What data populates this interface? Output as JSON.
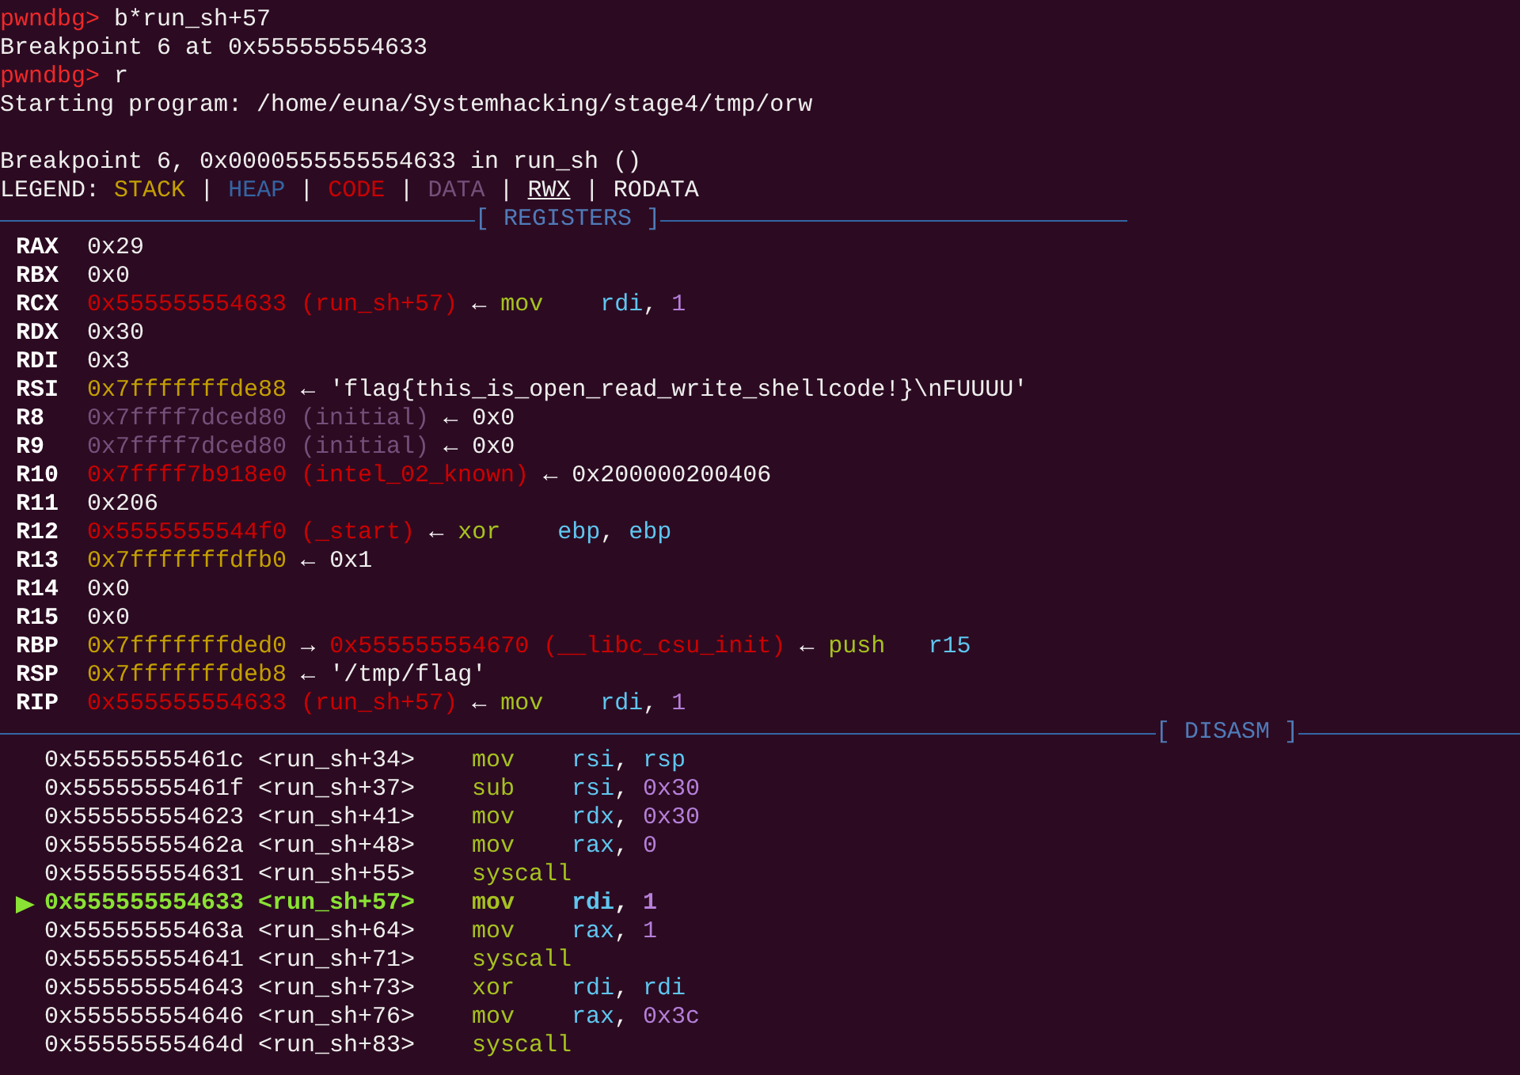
{
  "console": [
    {
      "kind": "output",
      "segments": [
        {
          "text": "pwndbg>",
          "kind": "prompt"
        },
        {
          "text": "b*run_sh+57",
          "kind": "plain"
        }
      ]
    },
    {
      "kind": "output",
      "segments": [
        {
          "text": "Breakpoint 6 at 0x555555554633",
          "kind": "plain"
        }
      ]
    },
    {
      "kind": "output",
      "segments": [
        {
          "text": "pwndbg>",
          "kind": "prompt"
        },
        {
          "text": "r",
          "kind": "plain"
        }
      ]
    },
    {
      "kind": "output",
      "segments": [
        {
          "text": "Starting program: /home/euna/Systemhacking/stage4/tmp/orw",
          "kind": "plain"
        }
      ]
    },
    {
      "kind": "blank"
    },
    {
      "kind": "output",
      "segments": [
        {
          "text": "Breakpoint 6, 0x0000555555554633 in run_sh ()",
          "kind": "plain"
        }
      ]
    },
    {
      "kind": "output",
      "segments": [
        {
          "text": "LEGEND:",
          "kind": "plain"
        },
        {
          "text": "STACK",
          "kind": "stack"
        },
        {
          "text": "|",
          "kind": "plain"
        },
        {
          "text": "HEAP",
          "kind": "heap"
        },
        {
          "text": "|",
          "kind": "plain"
        },
        {
          "text": "CODE",
          "kind": "code"
        },
        {
          "text": "|",
          "kind": "plain"
        },
        {
          "text": "DATA",
          "kind": "data"
        },
        {
          "text": "|",
          "kind": "plain"
        },
        {
          "text": "RWX",
          "kind": "rwx"
        },
        {
          "text": "|",
          "kind": "plain"
        },
        {
          "text": "RODATA",
          "kind": "plain"
        }
      ]
    }
  ],
  "registers_header": "[ REGISTERS ]",
  "registers": [
    {
      "name": "RAX",
      "segments": [
        {
          "text": "0x29",
          "kind": "plain"
        }
      ]
    },
    {
      "name": "RBX",
      "segments": [
        {
          "text": "0x0",
          "kind": "plain"
        }
      ]
    },
    {
      "name": "RCX",
      "segments": [
        {
          "text": "0x555555554633 (run_sh+57)",
          "kind": "code"
        },
        {
          "text": "←",
          "kind": "arrow"
        },
        {
          "text": "mov",
          "kind": "op"
        },
        {
          "text": "rdi",
          "kind": "reg"
        },
        {
          "text": ",",
          "kind": "punct"
        },
        {
          "text": "1",
          "kind": "num"
        }
      ]
    },
    {
      "name": "RDX",
      "segments": [
        {
          "text": "0x30",
          "kind": "plain"
        }
      ]
    },
    {
      "name": "RDI",
      "segments": [
        {
          "text": "0x3",
          "kind": "plain"
        }
      ]
    },
    {
      "name": "RSI",
      "segments": [
        {
          "text": "0x7fffffffde88",
          "kind": "stack"
        },
        {
          "text": "←",
          "kind": "arrow"
        },
        {
          "text": "'flag{this_is_open_read_write_shellcode!}\\nFUUUU'",
          "kind": "plain"
        }
      ]
    },
    {
      "name": "R8",
      "segments": [
        {
          "text": "0x7ffff7dced80 (initial)",
          "kind": "data"
        },
        {
          "text": "←",
          "kind": "arrow"
        },
        {
          "text": "0x0",
          "kind": "plain"
        }
      ]
    },
    {
      "name": "R9",
      "segments": [
        {
          "text": "0x7ffff7dced80 (initial)",
          "kind": "data"
        },
        {
          "text": "←",
          "kind": "arrow"
        },
        {
          "text": "0x0",
          "kind": "plain"
        }
      ]
    },
    {
      "name": "R10",
      "segments": [
        {
          "text": "0x7ffff7b918e0 (intel_02_known)",
          "kind": "code"
        },
        {
          "text": "←",
          "kind": "arrow"
        },
        {
          "text": "0x200000200406",
          "kind": "plain"
        }
      ]
    },
    {
      "name": "R11",
      "segments": [
        {
          "text": "0x206",
          "kind": "plain"
        }
      ]
    },
    {
      "name": "R12",
      "segments": [
        {
          "text": "0x5555555544f0 (_start)",
          "kind": "code"
        },
        {
          "text": "←",
          "kind": "arrow"
        },
        {
          "text": "xor",
          "kind": "op"
        },
        {
          "text": "ebp",
          "kind": "reg"
        },
        {
          "text": ",",
          "kind": "punct"
        },
        {
          "text": "ebp",
          "kind": "reg"
        }
      ]
    },
    {
      "name": "R13",
      "segments": [
        {
          "text": "0x7fffffffdfb0",
          "kind": "stack"
        },
        {
          "text": "←",
          "kind": "arrow"
        },
        {
          "text": "0x1",
          "kind": "plain"
        }
      ]
    },
    {
      "name": "R14",
      "segments": [
        {
          "text": "0x0",
          "kind": "plain"
        }
      ]
    },
    {
      "name": "R15",
      "segments": [
        {
          "text": "0x0",
          "kind": "plain"
        }
      ]
    },
    {
      "name": "RBP",
      "segments": [
        {
          "text": "0x7fffffffded0",
          "kind": "stack"
        },
        {
          "text": "→",
          "kind": "arrow"
        },
        {
          "text": "0x555555554670 (__libc_csu_init)",
          "kind": "code"
        },
        {
          "text": "←",
          "kind": "arrow"
        },
        {
          "text": "push",
          "kind": "op"
        },
        {
          "text": "r15",
          "kind": "reg"
        }
      ]
    },
    {
      "name": "RSP",
      "segments": [
        {
          "text": "0x7fffffffdeb8",
          "kind": "stack"
        },
        {
          "text": "←",
          "kind": "arrow"
        },
        {
          "text": "'/tmp/flag'",
          "kind": "plain"
        }
      ]
    },
    {
      "name": "RIP",
      "segments": [
        {
          "text": "0x555555554633 (run_sh+57)",
          "kind": "code"
        },
        {
          "text": "←",
          "kind": "arrow"
        },
        {
          "text": "mov",
          "kind": "op"
        },
        {
          "text": "rdi",
          "kind": "reg"
        },
        {
          "text": ",",
          "kind": "punct"
        },
        {
          "text": "1",
          "kind": "num"
        }
      ]
    }
  ],
  "disasm_header": "[ DISASM ]",
  "disasm": [
    {
      "address": "0x55555555461c",
      "symbol": "<run_sh+34>",
      "mnemonic": "mov",
      "operands": [
        {
          "text": "rsi",
          "kind": "reg"
        },
        {
          "text": ",",
          "kind": "punct"
        },
        {
          "text": "rsp",
          "kind": "reg"
        }
      ],
      "selected": false
    },
    {
      "address": "0x55555555461f",
      "symbol": "<run_sh+37>",
      "mnemonic": "sub",
      "operands": [
        {
          "text": "rsi",
          "kind": "reg"
        },
        {
          "text": ",",
          "kind": "punct"
        },
        {
          "text": "0x30",
          "kind": "num"
        }
      ],
      "selected": false
    },
    {
      "address": "0x555555554623",
      "symbol": "<run_sh+41>",
      "mnemonic": "mov",
      "operands": [
        {
          "text": "rdx",
          "kind": "reg"
        },
        {
          "text": ",",
          "kind": "punct"
        },
        {
          "text": "0x30",
          "kind": "num"
        }
      ],
      "selected": false
    },
    {
      "address": "0x55555555462a",
      "symbol": "<run_sh+48>",
      "mnemonic": "mov",
      "operands": [
        {
          "text": "rax",
          "kind": "reg"
        },
        {
          "text": ",",
          "kind": "punct"
        },
        {
          "text": "0",
          "kind": "num"
        }
      ],
      "selected": false
    },
    {
      "address": "0x555555554631",
      "symbol": "<run_sh+55>",
      "mnemonic": "syscall",
      "selected": false
    },
    {
      "address": "0x555555554633",
      "symbol": "<run_sh+57>",
      "mnemonic": "mov",
      "operands": [
        {
          "text": "rdi",
          "kind": "reg"
        },
        {
          "text": ",",
          "kind": "punct"
        },
        {
          "text": "1",
          "kind": "num"
        }
      ],
      "selected": true
    },
    {
      "address": "0x55555555463a",
      "symbol": "<run_sh+64>",
      "mnemonic": "mov",
      "operands": [
        {
          "text": "rax",
          "kind": "reg"
        },
        {
          "text": ",",
          "kind": "punct"
        },
        {
          "text": "1",
          "kind": "num"
        }
      ],
      "selected": false
    },
    {
      "address": "0x555555554641",
      "symbol": "<run_sh+71>",
      "mnemonic": "syscall",
      "selected": false
    },
    {
      "address": "0x555555554643",
      "symbol": "<run_sh+73>",
      "mnemonic": "xor",
      "operands": [
        {
          "text": "rdi",
          "kind": "reg"
        },
        {
          "text": ",",
          "kind": "punct"
        },
        {
          "text": "rdi",
          "kind": "reg"
        }
      ],
      "selected": false
    },
    {
      "address": "0x555555554646",
      "symbol": "<run_sh+76>",
      "mnemonic": "mov",
      "operands": [
        {
          "text": "rax",
          "kind": "reg"
        },
        {
          "text": ",",
          "kind": "punct"
        },
        {
          "text": "0x3c",
          "kind": "num"
        }
      ],
      "selected": false
    },
    {
      "address": "0x55555555464d",
      "symbol": "<run_sh+83>",
      "mnemonic": "syscall",
      "selected": false
    }
  ]
}
